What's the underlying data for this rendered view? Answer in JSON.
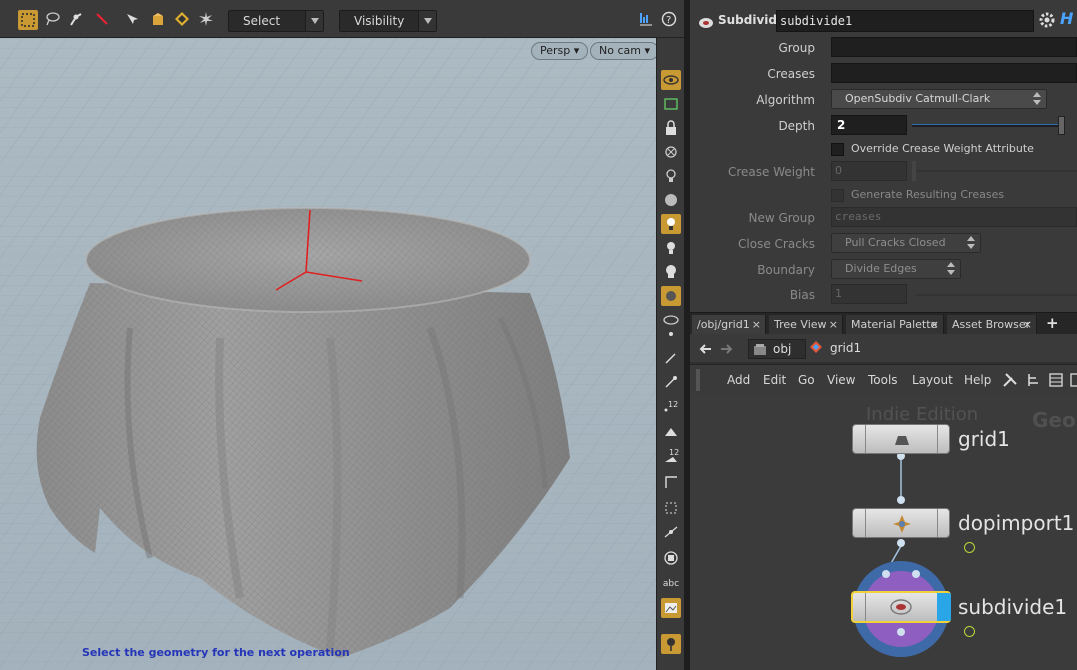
{
  "viewport": {
    "select_dropdown": "Select",
    "visibility_dropdown": "Visibility",
    "persp_button": "Persp",
    "cam_button": "No cam",
    "status_message": "Select the geometry for the next operation"
  },
  "params": {
    "node_type": "Subdivide",
    "node_name": "subdivide1",
    "brand_letter": "H",
    "group_label": "Group",
    "creases_label": "Creases",
    "algorithm_label": "Algorithm",
    "algorithm_value": "OpenSubdiv Catmull-Clark",
    "depth_label": "Depth",
    "depth_value": "2",
    "override_label": "Override Crease Weight Attribute",
    "crease_weight_label": "Crease Weight",
    "crease_weight_value": "0",
    "generate_creases_label": "Generate Resulting Creases",
    "new_group_label": "New Group",
    "new_group_value": "creases",
    "close_cracks_label": "Close Cracks",
    "close_cracks_value": "Pull Cracks Closed",
    "boundary_label": "Boundary",
    "boundary_value": "Divide Edges",
    "bias_label": "Bias",
    "bias_value": "1"
  },
  "network": {
    "tabs": [
      {
        "label": "/obj/grid1"
      },
      {
        "label": "Tree View"
      },
      {
        "label": "Material Palette"
      },
      {
        "label": "Asset Browser"
      }
    ],
    "tab_close": "×",
    "tab_add": "+",
    "path_obj": "obj",
    "path_node": "grid1",
    "menu": [
      "Add",
      "Edit",
      "Go",
      "View",
      "Tools",
      "Layout",
      "Help"
    ],
    "watermark": "Indie Edition",
    "watermark2": "Geo",
    "nodes": [
      {
        "label": "grid1"
      },
      {
        "label": "dopimport1"
      },
      {
        "label": "subdivide1"
      }
    ]
  },
  "colors": {
    "selected_toggle": "#c99a34",
    "node_selected_outline": "#f1d23a",
    "display_flag": "#2aa6e8",
    "status_text": "#2535b8",
    "handle_red": "#e02020"
  }
}
